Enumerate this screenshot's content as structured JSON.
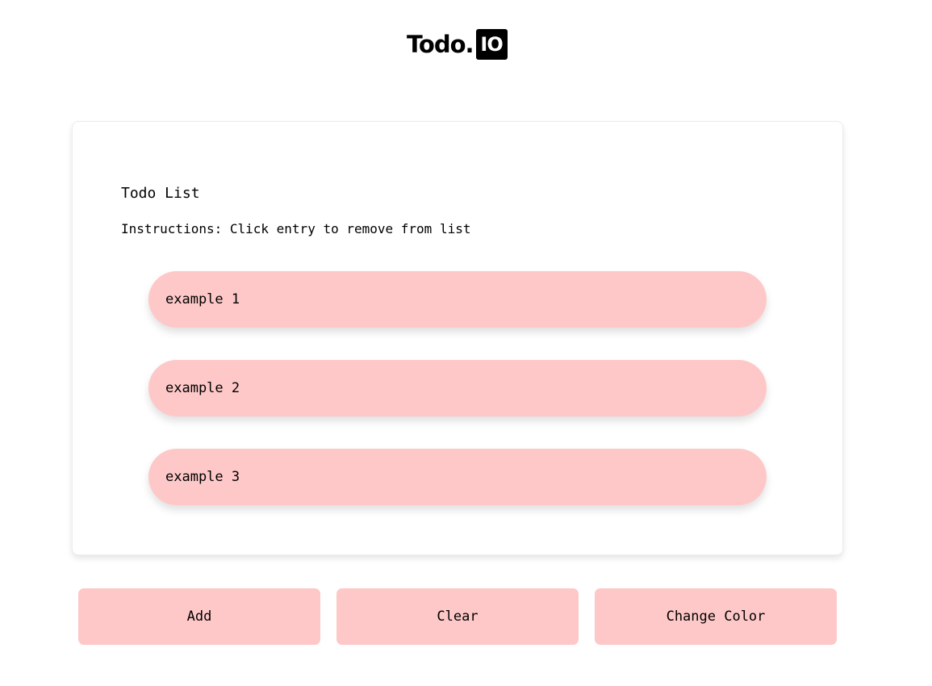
{
  "logo": {
    "text": "Todo.",
    "badge": "IO"
  },
  "card": {
    "title": "Todo List",
    "instructions": "Instructions: Click entry to remove from list"
  },
  "todos": [
    {
      "label": "example 1"
    },
    {
      "label": "example 2"
    },
    {
      "label": "example 3"
    }
  ],
  "actions": {
    "add_label": "Add",
    "clear_label": "Clear",
    "change_color_label": "Change Color"
  },
  "colors": {
    "accent": "#fec8c8",
    "background": "#ffffff",
    "text": "#000000"
  }
}
